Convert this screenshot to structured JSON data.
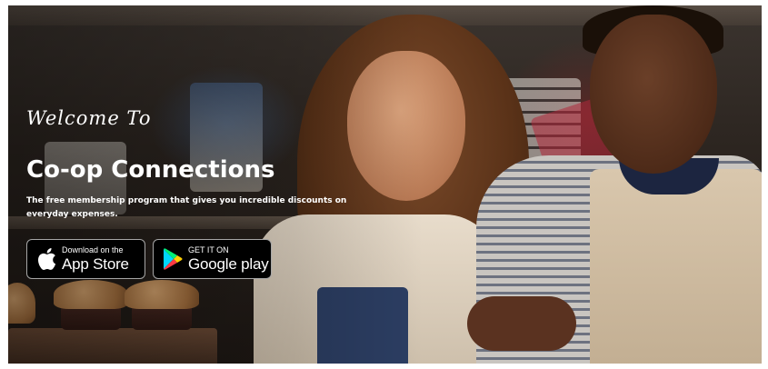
{
  "hero": {
    "welcome": "Welcome To",
    "title": "Co-op Connections",
    "subtitle": "The free membership program that gives you incredible discounts on everyday expenses."
  },
  "store_buttons": {
    "apple": {
      "small": "Download on the",
      "big": "App Store",
      "icon": "apple-icon"
    },
    "google": {
      "small": "GET IT ON",
      "big": "Google play",
      "icon": "google-play-icon"
    }
  },
  "colors": {
    "text": "#ffffff",
    "button_bg": "#000000",
    "button_border": "#a6a6a6"
  }
}
